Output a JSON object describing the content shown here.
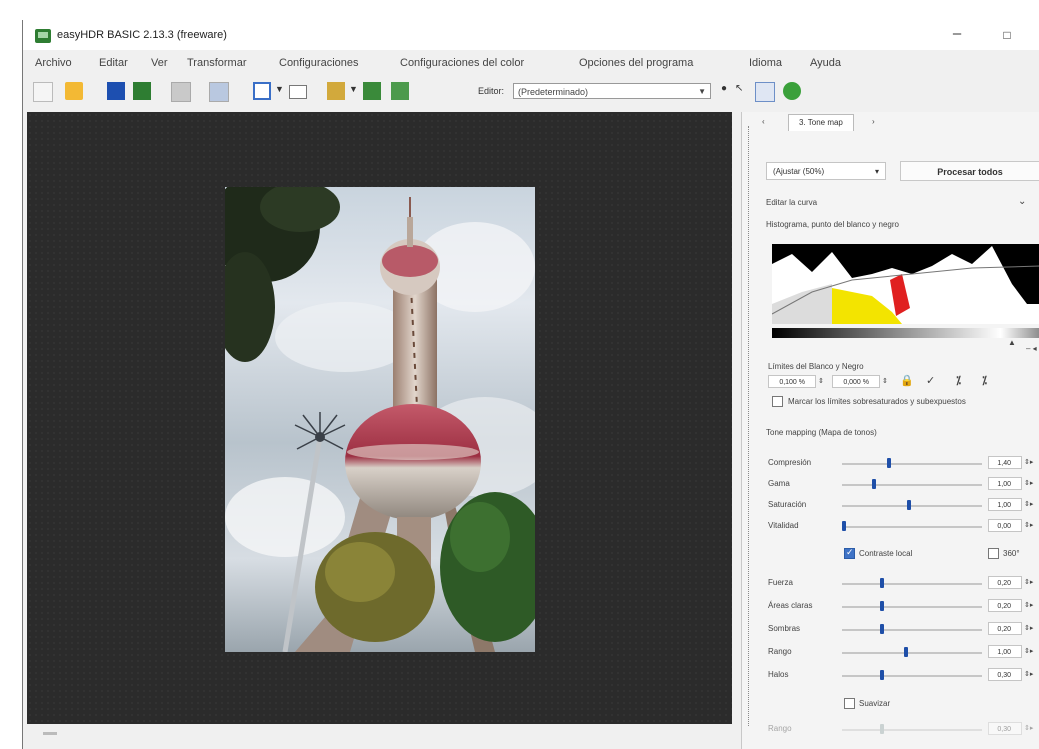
{
  "window": {
    "title": "easyHDR BASIC 2.13.3 (freeware)",
    "minimize": "–",
    "maximize": "□"
  },
  "menu": [
    "Archivo",
    "Editar",
    "Ver",
    "Transformar",
    "Configuraciones",
    "Configuraciones del color",
    "Opciones del programa",
    "Idioma",
    "Ayuda"
  ],
  "toolbar": {
    "editor_label": "Editor:",
    "editor_value": "(Predeterminado)"
  },
  "panel": {
    "tab_label": "3. Tone map",
    "zoom_value": "(Ajustar (50%)",
    "process_all": "Procesar todos",
    "curve_label": "Editar la curva",
    "histogram_label": "Histograma, punto del blanco y negro",
    "limits_label": "Límites del Blanco y Negro",
    "black_limit": "0,100 %",
    "white_limit": "0,000 %",
    "mark_label": "Marcar los límites sobresaturados y subexpuestos",
    "tonemap_label": "Tone mapping (Mapa de tonos)",
    "sliders": [
      {
        "label": "Compresión",
        "value": "1,40",
        "level": 0.3
      },
      {
        "label": "Gama",
        "value": "1,00",
        "level": 0.2
      },
      {
        "label": "Saturación",
        "value": "1,00",
        "level": 0.45
      },
      {
        "label": "Vitalidad",
        "value": "0,00",
        "level": 0.02
      }
    ],
    "local_contrast_label": "Contraste local",
    "deg_label": "360°",
    "local_sliders": [
      {
        "label": "Fuerza",
        "value": "0,20",
        "level": 0.25
      },
      {
        "label": "Áreas claras",
        "value": "0,20",
        "level": 0.25
      },
      {
        "label": "Sombras",
        "value": "0,20",
        "level": 0.25
      },
      {
        "label": "Rango",
        "value": "1,00",
        "level": 0.4
      },
      {
        "label": "Halos",
        "value": "0,30",
        "level": 0.25
      }
    ],
    "smooth_label": "Suavizar",
    "smooth_slider": {
      "label": "Rango",
      "value": "0,30",
      "level": 0.25
    }
  },
  "colors": {
    "canvas": "#2b2b2b",
    "accent": "#1f4fa8"
  }
}
